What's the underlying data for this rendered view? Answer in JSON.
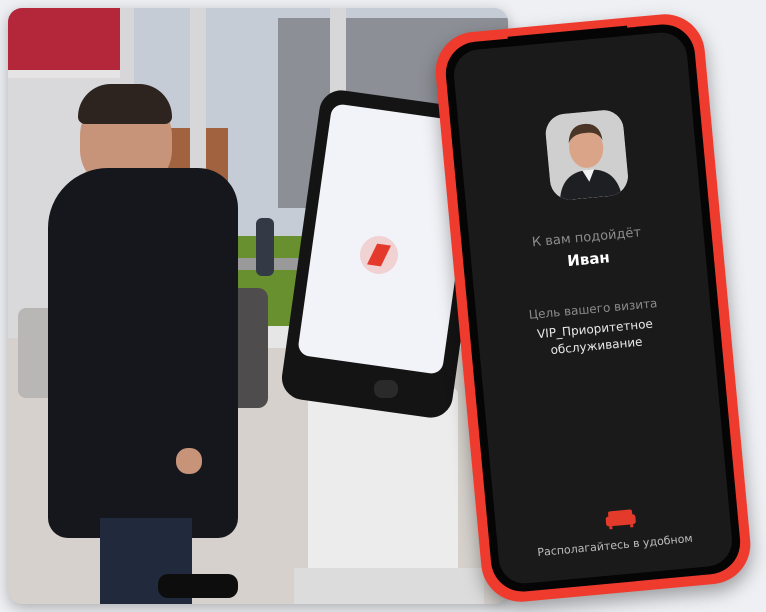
{
  "phone_screen": {
    "host_label": "К вам подойдёт",
    "host_name": "Иван",
    "purpose_label": "Цель вашего визита",
    "purpose_value_line1": "VIP_Приоритетное",
    "purpose_value_line2": "обслуживание",
    "bottom_text": "Располагайтесь в удобном",
    "avatar_icon": "person-avatar",
    "seat_icon": "sofa-icon"
  },
  "kiosk_screen": {
    "icon": "bank-logo-icon"
  },
  "colors": {
    "phone_body": "#ef3b2d",
    "screen_bg": "#1a1a1a",
    "accent": "#e33a2b"
  }
}
